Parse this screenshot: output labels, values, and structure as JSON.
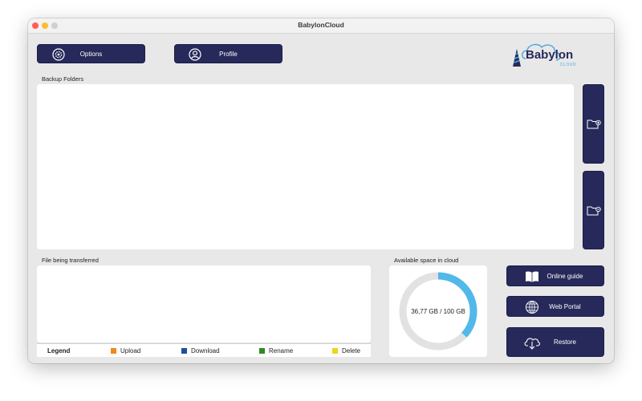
{
  "window": {
    "title": "BabylonCloud"
  },
  "logo": {
    "name": "Babylon",
    "sub": "CLOUD",
    "brand_color": "#27295a",
    "accent_color": "#4aa8e0"
  },
  "toolbar": {
    "options_label": "Options",
    "profile_label": "Profile"
  },
  "backup": {
    "section_label": "Backup Folders",
    "add_folder_icon": "folder-add-icon",
    "remove_folder_icon": "folder-remove-icon"
  },
  "transfer": {
    "section_label": "File being transferred"
  },
  "legend": {
    "title": "Legend",
    "items": [
      {
        "label": "Upload",
        "color": "#f08a1c"
      },
      {
        "label": "Download",
        "color": "#1f4fa0"
      },
      {
        "label": "Rename",
        "color": "#2e8b1e"
      },
      {
        "label": "Delete",
        "color": "#f2d21b"
      }
    ]
  },
  "storage": {
    "section_label": "Available space in cloud",
    "used_text": "36,77 GB / 100 GB",
    "used_fraction": 0.3677,
    "ring_color": "#52b8ea",
    "track_color": "#e2e2e2"
  },
  "actions": {
    "online_guide_label": "Online guide",
    "web_portal_label": "Web Portal",
    "restore_label": "Restore"
  },
  "colors": {
    "button_bg": "#27295a",
    "window_bg": "#e8e8e8"
  }
}
